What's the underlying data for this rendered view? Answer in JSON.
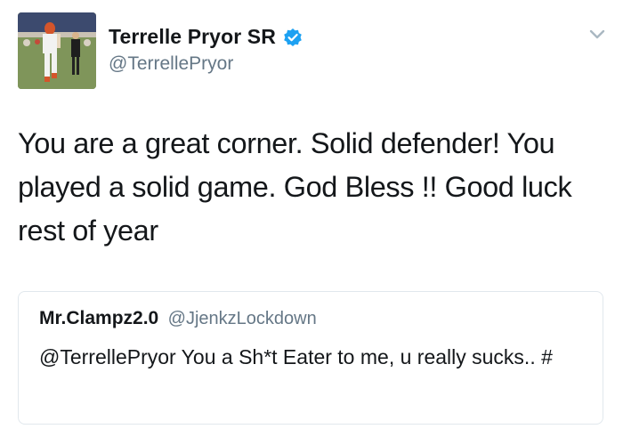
{
  "tweet": {
    "author": {
      "display_name": "Terrelle Pryor SR",
      "handle": "@TerrellePryor",
      "verified": true,
      "avatar_icon": "player-photo-avatar"
    },
    "text": "You are a great corner. Solid defender! You played a solid game. God Bless !! Good luck rest of year",
    "menu_icon": "chevron-down-icon"
  },
  "quoted_tweet": {
    "author": {
      "display_name": "Mr.Clampz2.0",
      "handle": "@JjenkzLockdown"
    },
    "text": "@TerrellePryor You a Sh*t Eater to me, u really sucks.. #"
  },
  "colors": {
    "verified_blue": "#1da1f2",
    "secondary_text": "#657786",
    "border": "#e1e8ed"
  }
}
